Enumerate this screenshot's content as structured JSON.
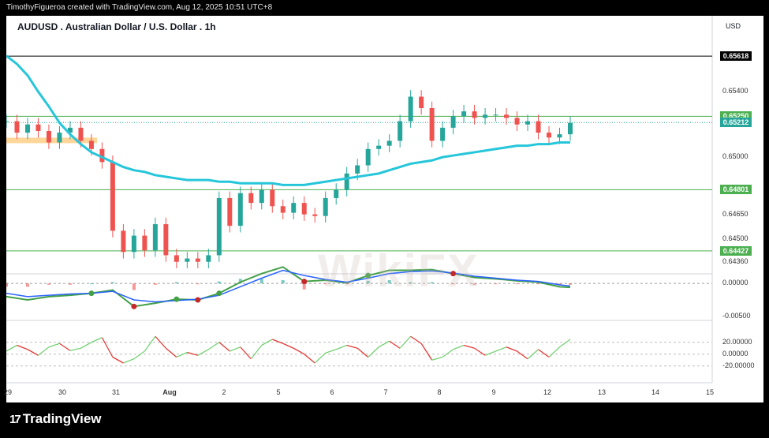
{
  "header": {
    "attribution": "TimothyFigueroa created with TradingView.com, Aug 12, 2025 10:51 UTC+8"
  },
  "symbol": {
    "title": "AUDUSD . Australian Dollar / U.S. Dollar . 1h",
    "currency": "USD"
  },
  "price_tags": [
    {
      "label": "0.65618",
      "color": "#000000"
    },
    {
      "label": "0.65250",
      "color": "#4caf50"
    },
    {
      "label": "0.65212",
      "color": "#26a69a"
    },
    {
      "label": "0.64801",
      "color": "#4caf50"
    },
    {
      "label": "0.64427",
      "color": "#4caf50"
    }
  ],
  "watermark": "WikiFX",
  "brand": {
    "name": "TradingView"
  },
  "chart_data": [
    {
      "type": "line",
      "panel": "price",
      "title": "AUDUSD . Australian Dollar / U.S. Dollar . 1h",
      "y_axis_ticks": [
        "0.65400",
        "0.65000",
        "0.64650",
        "0.64500",
        "0.64360"
      ],
      "ylim": [
        0.6432,
        0.6572
      ],
      "x_axis_ticks": [
        "29",
        "30",
        "31",
        "Aug",
        "2",
        "5",
        "6",
        "7",
        "8",
        "9",
        "12",
        "13",
        "14",
        "15"
      ],
      "horizontal_levels": [
        0.65618,
        0.6525,
        0.64801,
        0.64427
      ],
      "last_price": 0.65212,
      "x": [
        0,
        2,
        4,
        6,
        8,
        10,
        12,
        14,
        16,
        18,
        20,
        22,
        24,
        26,
        28,
        30,
        32,
        34,
        36,
        38,
        40,
        42,
        44,
        46,
        48,
        50,
        52,
        54,
        56,
        58,
        60,
        62,
        64,
        66,
        68,
        70,
        72,
        74,
        76,
        78,
        80,
        82,
        84,
        86,
        88,
        90,
        92,
        94,
        96,
        98,
        100,
        102,
        104,
        106
      ],
      "series": [
        {
          "name": "AUDUSD",
          "color": "#26a69a",
          "values": [
            0.6522,
            0.6515,
            0.652,
            0.6516,
            0.6509,
            0.6515,
            0.6518,
            0.651,
            0.6505,
            0.6497,
            0.6455,
            0.6442,
            0.6452,
            0.6443,
            0.6459,
            0.644,
            0.6436,
            0.6438,
            0.6436,
            0.644,
            0.6475,
            0.6458,
            0.6478,
            0.6472,
            0.648,
            0.647,
            0.6466,
            0.6472,
            0.6465,
            0.6464,
            0.6475,
            0.648,
            0.649,
            0.6495,
            0.6505,
            0.6507,
            0.651,
            0.6522,
            0.6537,
            0.653,
            0.651,
            0.6518,
            0.6525,
            0.6528,
            0.6524,
            0.6526,
            0.6526,
            0.6524,
            0.652,
            0.6522,
            0.6515,
            0.6512,
            0.6514,
            0.6521
          ]
        },
        {
          "name": "",
          "color": "#26c6da",
          "values": [
            0.6562,
            0.6557,
            0.655,
            0.654,
            0.6531,
            0.6521,
            0.6514,
            0.6508,
            0.6503,
            0.65,
            0.6497,
            0.6494,
            0.6492,
            0.6491,
            0.6489,
            0.6488,
            0.6487,
            0.6486,
            0.6486,
            0.6486,
            0.6485,
            0.6485,
            0.6484,
            0.6484,
            0.6484,
            0.6484,
            0.6483,
            0.6483,
            0.6483,
            0.6484,
            0.6485,
            0.6486,
            0.6487,
            0.6488,
            0.6489,
            0.649,
            0.6492,
            0.6494,
            0.6496,
            0.6497,
            0.6498,
            0.65,
            0.6501,
            0.6502,
            0.6503,
            0.6504,
            0.6505,
            0.6506,
            0.6507,
            0.6507,
            0.6508,
            0.6508,
            0.6509,
            0.6509
          ]
        }
      ]
    },
    {
      "type": "line",
      "panel": "macd",
      "y_axis_ticks": [
        "0.00000",
        "-0.00500"
      ],
      "ylim": [
        -0.0055,
        0.0035
      ],
      "x": [
        0,
        4,
        8,
        12,
        16,
        20,
        24,
        28,
        32,
        36,
        40,
        44,
        48,
        52,
        56,
        60,
        64,
        68,
        72,
        76,
        80,
        84,
        88,
        92,
        96,
        100,
        104,
        106
      ],
      "series": [
        {
          "name": "",
          "color": "#43a047",
          "values": [
            -0.002,
            -0.0025,
            -0.002,
            -0.0018,
            -0.0015,
            -0.001,
            -0.0035,
            -0.003,
            -0.0024,
            -0.0025,
            -0.0015,
            0.0002,
            0.0015,
            0.0025,
            0.0003,
            0.0005,
            0.0001,
            0.0012,
            0.002,
            0.002,
            0.0021,
            0.0015,
            0.0009,
            0.0007,
            0.0004,
            0.0002,
            -0.0005,
            -0.0006
          ]
        },
        {
          "name": "",
          "color": "#2962ff",
          "values": [
            -0.0015,
            -0.002,
            -0.0018,
            -0.0016,
            -0.0015,
            -0.0012,
            -0.0025,
            -0.0028,
            -0.0026,
            -0.0024,
            -0.0018,
            -0.0005,
            0.0008,
            0.002,
            0.0012,
            0.0006,
            0.0002,
            0.0008,
            0.0015,
            0.0018,
            0.0019,
            0.0016,
            0.0011,
            0.0008,
            0.0005,
            0.0003,
            -0.0002,
            -0.0004
          ]
        }
      ]
    },
    {
      "type": "line",
      "panel": "oscillator",
      "y_axis_ticks": [
        "20.00000",
        "0.00000",
        "-20.00000"
      ],
      "ylim": [
        -35,
        45
      ],
      "x": [
        0,
        2,
        4,
        6,
        8,
        10,
        12,
        14,
        16,
        18,
        20,
        22,
        24,
        26,
        28,
        30,
        32,
        34,
        36,
        38,
        40,
        42,
        44,
        46,
        48,
        50,
        52,
        54,
        56,
        58,
        60,
        62,
        64,
        66,
        68,
        70,
        72,
        74,
        76,
        78,
        80,
        82,
        84,
        86,
        88,
        90,
        92,
        94,
        96,
        98,
        100,
        102,
        104,
        106
      ],
      "series": [
        {
          "name": "",
          "color": "#e53935",
          "values": [
            5,
            15,
            8,
            -2,
            12,
            18,
            6,
            10,
            20,
            28,
            -5,
            -15,
            -8,
            5,
            30,
            10,
            -5,
            3,
            -2,
            8,
            20,
            5,
            12,
            -8,
            15,
            25,
            18,
            10,
            0,
            -15,
            2,
            8,
            15,
            10,
            -5,
            12,
            22,
            10,
            30,
            18,
            -10,
            -5,
            8,
            15,
            10,
            -2,
            5,
            12,
            5,
            -8,
            8,
            -5,
            12,
            25
          ]
        }
      ]
    }
  ]
}
